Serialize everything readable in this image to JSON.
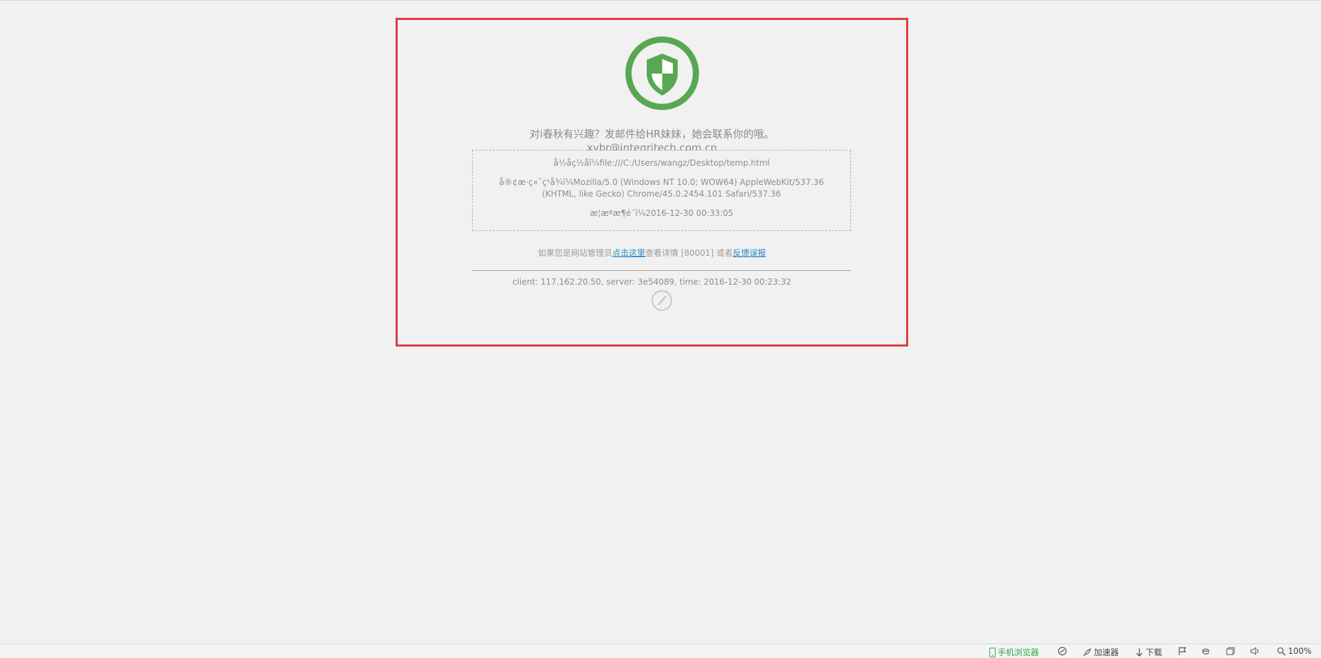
{
  "page": {
    "headline": "对i春秋有兴趣？发邮件给HR妹妹，她会联系你的哦。",
    "email": "xybr@integritech.com.cn",
    "info": {
      "url_line": "å½åç½åï¼file:///C:/Users/wangz/Desktop/temp.html",
      "ua_line": "å®¢æ·ç«¯ç¹å¾ï¼Mozilla/5.0 (Windows NT 10.0; WOW64) AppleWebKit/537.36 (KHTML, like Gecko) Chrome/45.0.2454.101 Safari/537.36",
      "time_line": "æ¦æªæ¶é´ï¼2016-12-30 00:33:05"
    },
    "admin_prefix": "如果您是网站管理员",
    "admin_link": "点击这里",
    "admin_middle": "查看详情 [80001] 或者",
    "feedback_link": "反馈误报",
    "client_line": "client: 117.162.20.50, server: 3e54089, time: 2016-12-30 00:23:32"
  },
  "colors": {
    "shield_green": "#58a852",
    "highlight_border": "#e0393e",
    "link_blue": "#2a86c9"
  },
  "statusbar": {
    "mobile_browser": "手机浏览器",
    "accelerator": "加速器",
    "download": "下载",
    "zoom": "100%"
  }
}
